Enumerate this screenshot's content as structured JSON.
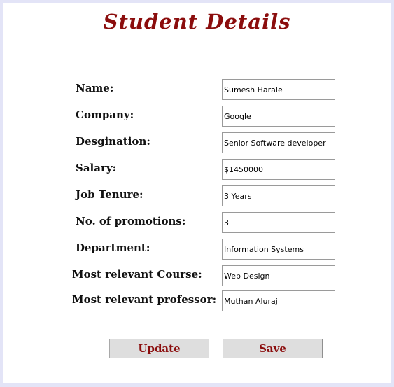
{
  "page": {
    "title": "Student Details"
  },
  "form": {
    "fields": [
      {
        "label": "Name:",
        "value": "Sumesh Harale"
      },
      {
        "label": "Company:",
        "value": "Google"
      },
      {
        "label": "Desgination:",
        "value": "Senior Software developer"
      },
      {
        "label": "Salary:",
        "value": "$1450000"
      },
      {
        "label": "Job Tenure:",
        "value": "3 Years"
      },
      {
        "label": "No. of promotions:",
        "value": "3"
      },
      {
        "label": "Department:",
        "value": "Information Systems"
      },
      {
        "label": "Most relevant Course:",
        "value": "Web Design"
      },
      {
        "label": "Most relevant professor:",
        "value": "Muthan Aluraj"
      }
    ]
  },
  "actions": {
    "update_label": "Update",
    "save_label": "Save"
  },
  "colors": {
    "accent": "#8b0d0d",
    "background": "#e3e4f7",
    "button_face": "#dedede"
  }
}
